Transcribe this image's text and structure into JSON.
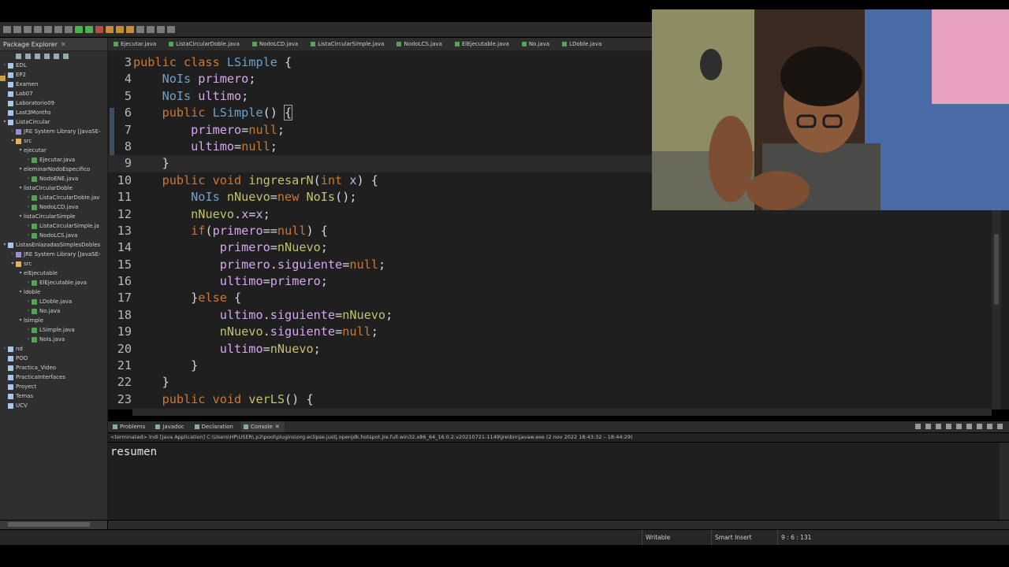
{
  "package_explorer": {
    "tab_label": "Package Explorer",
    "tree": [
      {
        "indent": 0,
        "toggle": ">",
        "icon": "folder",
        "label": "EDL"
      },
      {
        "indent": 0,
        "toggle": ">",
        "icon": "folder",
        "label": "EP2"
      },
      {
        "indent": 0,
        "toggle": "",
        "icon": "folder",
        "label": "Examen"
      },
      {
        "indent": 0,
        "toggle": "",
        "icon": "folder",
        "label": "Lab07"
      },
      {
        "indent": 0,
        "toggle": "",
        "icon": "folder",
        "label": "Laboratorio09"
      },
      {
        "indent": 0,
        "toggle": "",
        "icon": "folder",
        "label": "Last3Months"
      },
      {
        "indent": 0,
        "toggle": "v",
        "icon": "folder",
        "label": "ListaCircular"
      },
      {
        "indent": 1,
        "toggle": ">",
        "icon": "lib",
        "label": "JRE System Library [JavaSE-"
      },
      {
        "indent": 1,
        "toggle": "v",
        "icon": "src",
        "label": "src"
      },
      {
        "indent": 2,
        "toggle": "v",
        "icon": "pkg",
        "label": "ejecutar"
      },
      {
        "indent": 3,
        "toggle": ">",
        "icon": "java",
        "label": "Ejecutar.java"
      },
      {
        "indent": 2,
        "toggle": "v",
        "icon": "pkg",
        "label": "eleminarNodoEspecifico"
      },
      {
        "indent": 3,
        "toggle": ">",
        "icon": "java",
        "label": "NodoENE.java"
      },
      {
        "indent": 2,
        "toggle": "v",
        "icon": "pkg",
        "label": "listaCircularDoble"
      },
      {
        "indent": 3,
        "toggle": ">",
        "icon": "java",
        "label": "ListaCircularDoble.jav"
      },
      {
        "indent": 3,
        "toggle": ">",
        "icon": "java",
        "label": "NodoLCD.java"
      },
      {
        "indent": 2,
        "toggle": "v",
        "icon": "pkg",
        "label": "listaCircularSimple"
      },
      {
        "indent": 3,
        "toggle": ">",
        "icon": "java",
        "label": "ListaCircularSimple.ja"
      },
      {
        "indent": 3,
        "toggle": ">",
        "icon": "java",
        "label": "NodoLCS.java"
      },
      {
        "indent": 0,
        "toggle": "v",
        "icon": "folder",
        "label": "ListasEnlazadasSimplesDobles"
      },
      {
        "indent": 1,
        "toggle": ">",
        "icon": "lib",
        "label": "JRE System Library [JavaSE-"
      },
      {
        "indent": 1,
        "toggle": "v",
        "icon": "src",
        "label": "src"
      },
      {
        "indent": 2,
        "toggle": "v",
        "icon": "pkg",
        "label": "elEjecutable"
      },
      {
        "indent": 3,
        "toggle": ">",
        "icon": "java",
        "label": "ElEjecutable.java"
      },
      {
        "indent": 2,
        "toggle": "v",
        "icon": "pkg",
        "label": "ldoble"
      },
      {
        "indent": 3,
        "toggle": ">",
        "icon": "java",
        "label": "LDoble.java"
      },
      {
        "indent": 3,
        "toggle": ">",
        "icon": "java",
        "label": "No.java"
      },
      {
        "indent": 2,
        "toggle": "v",
        "icon": "pkg",
        "label": "lsimple"
      },
      {
        "indent": 3,
        "toggle": ">",
        "icon": "java",
        "label": "LSimple.java"
      },
      {
        "indent": 3,
        "toggle": ">",
        "icon": "java",
        "label": "NoIs.java"
      },
      {
        "indent": 0,
        "toggle": ">",
        "icon": "folder",
        "label": "nd"
      },
      {
        "indent": 0,
        "toggle": "",
        "icon": "folder",
        "label": "POO"
      },
      {
        "indent": 0,
        "toggle": "",
        "icon": "folder",
        "label": "Practica_Video"
      },
      {
        "indent": 0,
        "toggle": "",
        "icon": "folder",
        "label": "PracticaInterfaces"
      },
      {
        "indent": 0,
        "toggle": "",
        "icon": "folder",
        "label": "Proyect"
      },
      {
        "indent": 0,
        "toggle": "",
        "icon": "folder",
        "label": "Temas"
      },
      {
        "indent": 0,
        "toggle": "",
        "icon": "folder",
        "label": "UCV"
      }
    ]
  },
  "editor_tabs": [
    "Ejecutar.java",
    "ListaCircularDoble.java",
    "NodoLCD.java",
    "ListaCircularSimple.java",
    "NodoLCS.java",
    "ElEjecutable.java",
    "No.java",
    "LDoble.java"
  ],
  "editor": {
    "lines": [
      {
        "n": "3",
        "toks": [
          [
            "kw",
            "public "
          ],
          [
            "kw",
            "class "
          ],
          [
            "ty",
            "LSimple "
          ],
          [
            "op",
            "{"
          ]
        ]
      },
      {
        "n": "4",
        "toks": [
          [
            "op",
            "    "
          ],
          [
            "ty",
            "NoIs "
          ],
          [
            "fld",
            "primero"
          ],
          [
            "op",
            ";"
          ]
        ]
      },
      {
        "n": "5",
        "toks": [
          [
            "op",
            "    "
          ],
          [
            "ty",
            "NoIs "
          ],
          [
            "fld",
            "ultimo"
          ],
          [
            "op",
            ";"
          ]
        ]
      },
      {
        "n": "6",
        "toks": [
          [
            "op",
            "    "
          ],
          [
            "kw",
            "public "
          ],
          [
            "ty",
            "LSimple"
          ],
          [
            "op",
            "() "
          ],
          [
            "hl",
            "{"
          ]
        ]
      },
      {
        "n": "7",
        "toks": [
          [
            "op",
            "        "
          ],
          [
            "fld",
            "primero"
          ],
          [
            "op",
            "="
          ],
          [
            "nl",
            "null"
          ],
          [
            "op",
            ";"
          ]
        ]
      },
      {
        "n": "8",
        "toks": [
          [
            "op",
            "        "
          ],
          [
            "fld",
            "ultimo"
          ],
          [
            "op",
            "="
          ],
          [
            "nl",
            "null"
          ],
          [
            "op",
            ";"
          ]
        ]
      },
      {
        "n": "9",
        "toks": [
          [
            "op",
            "    }"
          ]
        ],
        "current": true
      },
      {
        "n": "10",
        "toks": [
          [
            "op",
            "    "
          ],
          [
            "kw",
            "public "
          ],
          [
            "kw",
            "void "
          ],
          [
            "fn",
            "ingresarN"
          ],
          [
            "op",
            "("
          ],
          [
            "kw",
            "int "
          ],
          [
            "pr",
            "x"
          ],
          [
            "op",
            ") {"
          ]
        ]
      },
      {
        "n": "11",
        "toks": [
          [
            "op",
            "        "
          ],
          [
            "ty",
            "NoIs "
          ],
          [
            "fn",
            "nNuevo"
          ],
          [
            "op",
            "="
          ],
          [
            "kw",
            "new "
          ],
          [
            "fn",
            "NoIs"
          ],
          [
            "op",
            "();"
          ]
        ]
      },
      {
        "n": "12",
        "toks": [
          [
            "op",
            "        "
          ],
          [
            "fn",
            "nNuevo"
          ],
          [
            "op",
            "."
          ],
          [
            "fld",
            "x"
          ],
          [
            "op",
            "="
          ],
          [
            "pr",
            "x"
          ],
          [
            "op",
            ";"
          ]
        ]
      },
      {
        "n": "13",
        "toks": [
          [
            "op",
            "        "
          ],
          [
            "kw",
            "if"
          ],
          [
            "op",
            "("
          ],
          [
            "fld",
            "primero"
          ],
          [
            "op",
            "=="
          ],
          [
            "nl",
            "null"
          ],
          [
            "op",
            ") {"
          ]
        ]
      },
      {
        "n": "14",
        "toks": [
          [
            "op",
            "            "
          ],
          [
            "fld",
            "primero"
          ],
          [
            "op",
            "="
          ],
          [
            "fn",
            "nNuevo"
          ],
          [
            "op",
            ";"
          ]
        ]
      },
      {
        "n": "15",
        "toks": [
          [
            "op",
            "            "
          ],
          [
            "fld",
            "primero"
          ],
          [
            "op",
            "."
          ],
          [
            "fld",
            "siguiente"
          ],
          [
            "op",
            "="
          ],
          [
            "nl",
            "null"
          ],
          [
            "op",
            ";"
          ]
        ]
      },
      {
        "n": "16",
        "toks": [
          [
            "op",
            "            "
          ],
          [
            "fld",
            "ultimo"
          ],
          [
            "op",
            "="
          ],
          [
            "fld",
            "primero"
          ],
          [
            "op",
            ";"
          ]
        ]
      },
      {
        "n": "17",
        "toks": [
          [
            "op",
            "        }"
          ],
          [
            "kw",
            "else "
          ],
          [
            "op",
            "{"
          ]
        ]
      },
      {
        "n": "18",
        "toks": [
          [
            "op",
            "            "
          ],
          [
            "fld",
            "ultimo"
          ],
          [
            "op",
            "."
          ],
          [
            "fld",
            "siguiente"
          ],
          [
            "op",
            "="
          ],
          [
            "fn",
            "nNuevo"
          ],
          [
            "op",
            ";"
          ]
        ]
      },
      {
        "n": "19",
        "toks": [
          [
            "op",
            "            "
          ],
          [
            "fn",
            "nNuevo"
          ],
          [
            "op",
            "."
          ],
          [
            "fld",
            "siguiente"
          ],
          [
            "op",
            "="
          ],
          [
            "nl",
            "null"
          ],
          [
            "op",
            ";"
          ]
        ]
      },
      {
        "n": "20",
        "toks": [
          [
            "op",
            "            "
          ],
          [
            "fld",
            "ultimo"
          ],
          [
            "op",
            "="
          ],
          [
            "fn",
            "nNuevo"
          ],
          [
            "op",
            ";"
          ]
        ]
      },
      {
        "n": "21",
        "toks": [
          [
            "op",
            "        }"
          ]
        ]
      },
      {
        "n": "22",
        "toks": [
          [
            "op",
            "    }"
          ]
        ]
      },
      {
        "n": "23",
        "toks": [
          [
            "op",
            "    "
          ],
          [
            "kw",
            "public "
          ],
          [
            "kw",
            "void "
          ],
          [
            "fn",
            "verLS"
          ],
          [
            "op",
            "() {"
          ]
        ]
      }
    ]
  },
  "bottom_panel": {
    "tabs": [
      "Problems",
      "Javadoc",
      "Declaration",
      "Console"
    ],
    "active_tab": "Console",
    "terminated_line": "<terminated> lndi [Java Application] C:\\Users\\HP\\USER\\.p2\\pool\\plugins\\org.eclipse.justj.openjdk.hotspot.jre.full.win32.x86_64_16.0.2.v20210721-1149\\jre\\bin\\javaw.exe (2 nov 2022 18:43:32 – 18:44:29)",
    "console_output": "resumen"
  },
  "status_bar": {
    "writable": "Writable",
    "insert_mode": "Smart Insert",
    "position": "9 : 6 : 131"
  }
}
